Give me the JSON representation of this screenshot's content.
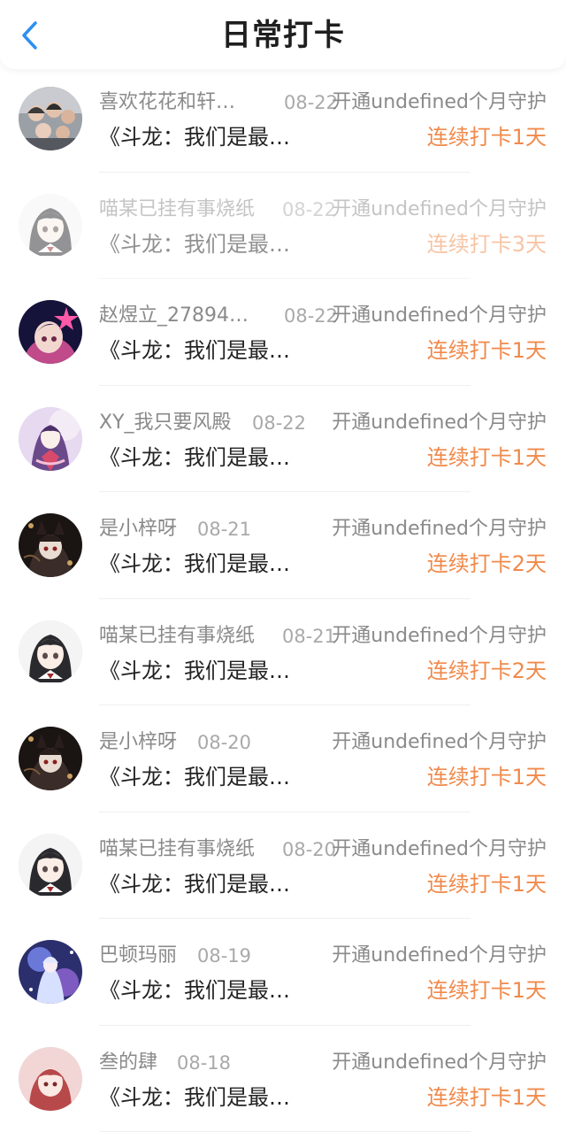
{
  "header": {
    "title": "日常打卡"
  },
  "colors": {
    "streak": "#f08a4b",
    "muted": "#8a8a8a",
    "text": "#232323",
    "back": "#2e8ff0"
  },
  "items": [
    {
      "name": "喜欢花花和轩…",
      "date": "08-22",
      "guard": "开通undefined个月守护",
      "content": "《斗龙：我们是最…",
      "streak": "连续打卡1天",
      "avatar": "group-photo",
      "faded": false
    },
    {
      "name": "喵某已挂有事烧纸",
      "date": "08-22",
      "guard": "开通undefined个月守护",
      "content": "《斗龙：我们是最…",
      "streak": "连续打卡3天",
      "avatar": "anime-girl",
      "faded": true
    },
    {
      "name": "赵煜立_278947…",
      "date": "08-22",
      "guard": "开通undefined个月守护",
      "content": "《斗龙：我们是最…",
      "streak": "连续打卡1天",
      "avatar": "star-character",
      "faded": false
    },
    {
      "name": "XY_我只要风殿",
      "date": "08-22",
      "guard": "开通undefined个月守护",
      "content": "《斗龙：我们是最…",
      "streak": "连续打卡1天",
      "avatar": "fantasy-girl",
      "faded": false
    },
    {
      "name": "是小梓呀",
      "date": "08-21",
      "guard": "开通undefined个月守护",
      "content": "《斗龙：我们是最…",
      "streak": "连续打卡2天",
      "avatar": "dark-fox",
      "faded": false
    },
    {
      "name": "喵某已挂有事烧纸",
      "date": "08-21",
      "guard": "开通undefined个月守护",
      "content": "《斗龙：我们是最…",
      "streak": "连续打卡2天",
      "avatar": "anime-girl",
      "faded": false
    },
    {
      "name": "是小梓呀",
      "date": "08-20",
      "guard": "开通undefined个月守护",
      "content": "《斗龙：我们是最…",
      "streak": "连续打卡1天",
      "avatar": "dark-fox",
      "faded": false
    },
    {
      "name": "喵某已挂有事烧纸",
      "date": "08-20",
      "guard": "开通undefined个月守护",
      "content": "《斗龙：我们是最…",
      "streak": "连续打卡1天",
      "avatar": "anime-girl",
      "faded": false
    },
    {
      "name": "巴顿玛丽",
      "date": "08-19",
      "guard": "开通undefined个月守护",
      "content": "《斗龙：我们是最…",
      "streak": "连续打卡1天",
      "avatar": "blue-fantasy",
      "faded": false
    },
    {
      "name": "叁的肆",
      "date": "08-18",
      "guard": "开通undefined个月守护",
      "content": "《斗龙：我们是最…",
      "streak": "连续打卡1天",
      "avatar": "pink-character",
      "faded": false
    }
  ]
}
